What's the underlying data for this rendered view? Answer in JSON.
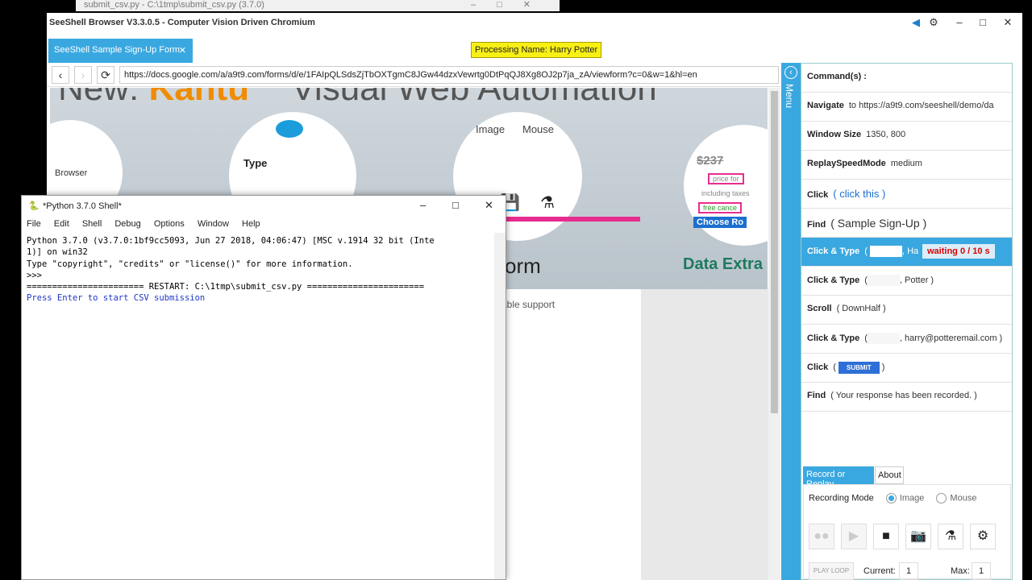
{
  "bg_window": {
    "title": "submit_csv.py - C:\\1tmp\\submit_csv.py (3.7.0)"
  },
  "main_window": {
    "title": "SeeShell Browser V3.3.0.5 - Computer Vision Driven Chromium"
  },
  "tab": {
    "label": "SeeShell Sample Sign-Up Form",
    "close": "✕"
  },
  "processing_badge": "Processing Name: Harry Potter",
  "navigation": {
    "back": "‹",
    "forward": "›",
    "reload": "⟳",
    "url": "https://docs.google.com/a/a9t9.com/forms/d/e/1FAIpQLSdsZjTbOXTgmC8JGw44dzxVewrtg0DtPqQJ8Xg8OJ2p7ja_zA/viewform?c=0&w=1&hl=en"
  },
  "webpage": {
    "banner_prefix": "New:",
    "banner_brand": "Kantu",
    "banner_rest": "Visual Web Automation",
    "type_label": "Type",
    "image_label": "Image",
    "mouse_label": "Mouse",
    "browser_label": "Browser",
    "price_label": "$237",
    "price_for": "price for",
    "taxes_label": "including taxes",
    "cancel_label": "free cance",
    "choose_label": "Choose Ro",
    "data_extraction": "Data Extra",
    "form_title": "orm",
    "form_sub": "able support"
  },
  "menu_label": "Menu",
  "commands_header": "Command(s) :",
  "commands": [
    {
      "k": "Navigate",
      "v": "to https://a9t9.com/seeshell/demo/da"
    },
    {
      "k": "Window Size",
      "v": "1350, 800"
    },
    {
      "k": "ReplaySpeedMode",
      "v": "medium"
    },
    {
      "k": "Click",
      "v": "(  click this  )"
    },
    {
      "k": "Find",
      "v": "( Sample Sign-Up )"
    },
    {
      "k": "Click & Type",
      "v": "(",
      "v2": ", Ha",
      "status": "waiting   0 / 10 s"
    },
    {
      "k": "Click & Type",
      "v": "(",
      "v2": ", Potter )"
    },
    {
      "k": "Scroll",
      "v": "( DownHalf )"
    },
    {
      "k": "Click & Type",
      "v": "(",
      "v2": ", harry@potteremail.com )"
    },
    {
      "k": "Click",
      "v": "(",
      "v2": ")",
      "pill": "SUBMIT"
    },
    {
      "k": "Find",
      "v": "(  Your response has been recorded.  )"
    }
  ],
  "record": {
    "tab_record": "Record or Replay",
    "tab_about": "About",
    "mode_label": "Recording Mode",
    "opt_image": "Image",
    "opt_mouse": "Mouse",
    "play_loop": "PLAY LOOP",
    "current_label": "Current:",
    "current_value": "1",
    "max_label": "Max:",
    "max_value": "1"
  },
  "python_shell": {
    "title": "*Python 3.7.0 Shell*",
    "menus": [
      "File",
      "Edit",
      "Shell",
      "Debug",
      "Options",
      "Window",
      "Help"
    ],
    "line1": "Python 3.7.0 (v3.7.0:1bf9cc5093, Jun 27 2018, 04:06:47) [MSC v.1914 32 bit (Inte",
    "line2": "1)] on win32",
    "line3": "Type \"copyright\", \"credits\" or \"license()\" for more information.",
    "line4": ">>> ",
    "line5": "======================= RESTART: C:\\1tmp\\submit_csv.py =======================",
    "line6": "Press Enter to start CSV submission"
  }
}
